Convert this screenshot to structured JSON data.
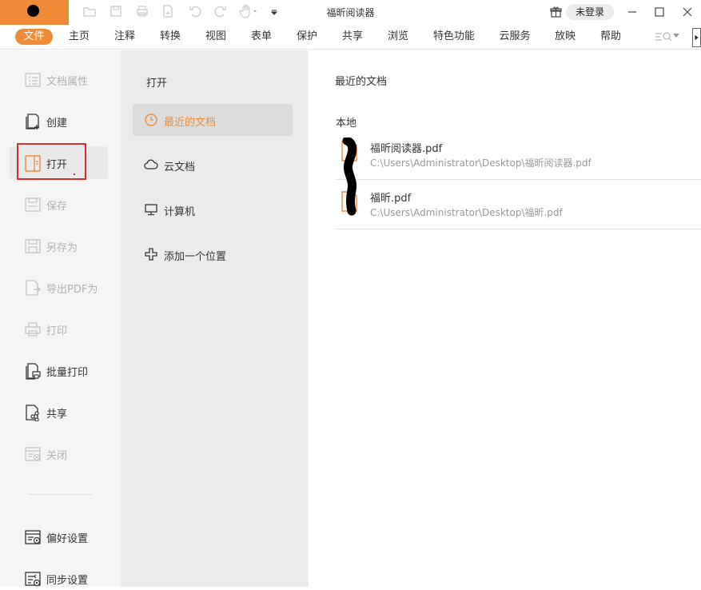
{
  "app": {
    "title": "福昕阅读器",
    "login_label": "未登录"
  },
  "menu": {
    "items": [
      "文件",
      "主页",
      "注释",
      "转换",
      "视图",
      "表单",
      "保护",
      "共享",
      "浏览",
      "特色功能",
      "云服务",
      "放映",
      "帮助"
    ],
    "active_index": 0
  },
  "sidebar": {
    "items": [
      {
        "label": "文档属性",
        "icon": "document-properties-icon",
        "enabled": false
      },
      {
        "label": "创建",
        "icon": "create-icon",
        "enabled": true
      },
      {
        "label": "打开",
        "icon": "open-icon",
        "enabled": true,
        "selected": true
      },
      {
        "label": "保存",
        "icon": "save-icon",
        "enabled": false
      },
      {
        "label": "另存为",
        "icon": "save-as-icon",
        "enabled": false
      },
      {
        "label": "导出PDF为",
        "icon": "export-pdf-icon",
        "enabled": false
      },
      {
        "label": "打印",
        "icon": "print-icon",
        "enabled": false
      },
      {
        "label": "批量打印",
        "icon": "batch-print-icon",
        "enabled": true
      },
      {
        "label": "共享",
        "icon": "share-icon",
        "enabled": true
      },
      {
        "label": "关闭",
        "icon": "close-doc-icon",
        "enabled": false
      }
    ],
    "bottom_items": [
      {
        "label": "偏好设置",
        "icon": "preferences-icon"
      },
      {
        "label": "同步设置",
        "icon": "sync-settings-icon"
      }
    ]
  },
  "open_panel": {
    "title": "打开",
    "items": [
      {
        "label": "最近的文档",
        "icon": "clock-icon",
        "active": true
      },
      {
        "label": "云文档",
        "icon": "cloud-icon"
      },
      {
        "label": "计算机",
        "icon": "computer-icon"
      },
      {
        "label": "添加一个位置",
        "icon": "add-location-icon"
      }
    ]
  },
  "recent": {
    "title": "最近的文档",
    "section_label": "本地",
    "files": [
      {
        "name": "福昕阅读器.pdf",
        "path": "C:\\Users\\Administrator\\Desktop\\福昕阅读器.pdf"
      },
      {
        "name": "福昕.pdf",
        "path": "C:\\Users\\Administrator\\Desktop\\福昕.pdf"
      }
    ]
  },
  "colors": {
    "accent": "#ef8a36",
    "highlight_box": "#e02a2a",
    "sidebar_bg": "#f5f5f5",
    "panel_bg": "#ebebeb"
  }
}
